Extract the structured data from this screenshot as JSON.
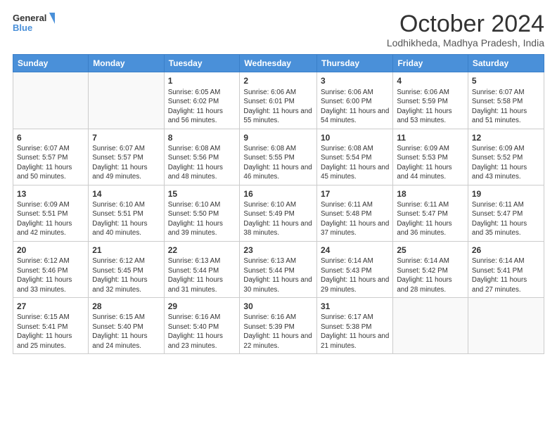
{
  "logo": {
    "line1": "General",
    "line2": "Blue"
  },
  "title": "October 2024",
  "subtitle": "Lodhikheda, Madhya Pradesh, India",
  "days_of_week": [
    "Sunday",
    "Monday",
    "Tuesday",
    "Wednesday",
    "Thursday",
    "Friday",
    "Saturday"
  ],
  "weeks": [
    [
      {
        "day": "",
        "info": ""
      },
      {
        "day": "",
        "info": ""
      },
      {
        "day": "1",
        "info": "Sunrise: 6:05 AM\nSunset: 6:02 PM\nDaylight: 11 hours and 56 minutes."
      },
      {
        "day": "2",
        "info": "Sunrise: 6:06 AM\nSunset: 6:01 PM\nDaylight: 11 hours and 55 minutes."
      },
      {
        "day": "3",
        "info": "Sunrise: 6:06 AM\nSunset: 6:00 PM\nDaylight: 11 hours and 54 minutes."
      },
      {
        "day": "4",
        "info": "Sunrise: 6:06 AM\nSunset: 5:59 PM\nDaylight: 11 hours and 53 minutes."
      },
      {
        "day": "5",
        "info": "Sunrise: 6:07 AM\nSunset: 5:58 PM\nDaylight: 11 hours and 51 minutes."
      }
    ],
    [
      {
        "day": "6",
        "info": "Sunrise: 6:07 AM\nSunset: 5:57 PM\nDaylight: 11 hours and 50 minutes."
      },
      {
        "day": "7",
        "info": "Sunrise: 6:07 AM\nSunset: 5:57 PM\nDaylight: 11 hours and 49 minutes."
      },
      {
        "day": "8",
        "info": "Sunrise: 6:08 AM\nSunset: 5:56 PM\nDaylight: 11 hours and 48 minutes."
      },
      {
        "day": "9",
        "info": "Sunrise: 6:08 AM\nSunset: 5:55 PM\nDaylight: 11 hours and 46 minutes."
      },
      {
        "day": "10",
        "info": "Sunrise: 6:08 AM\nSunset: 5:54 PM\nDaylight: 11 hours and 45 minutes."
      },
      {
        "day": "11",
        "info": "Sunrise: 6:09 AM\nSunset: 5:53 PM\nDaylight: 11 hours and 44 minutes."
      },
      {
        "day": "12",
        "info": "Sunrise: 6:09 AM\nSunset: 5:52 PM\nDaylight: 11 hours and 43 minutes."
      }
    ],
    [
      {
        "day": "13",
        "info": "Sunrise: 6:09 AM\nSunset: 5:51 PM\nDaylight: 11 hours and 42 minutes."
      },
      {
        "day": "14",
        "info": "Sunrise: 6:10 AM\nSunset: 5:51 PM\nDaylight: 11 hours and 40 minutes."
      },
      {
        "day": "15",
        "info": "Sunrise: 6:10 AM\nSunset: 5:50 PM\nDaylight: 11 hours and 39 minutes."
      },
      {
        "day": "16",
        "info": "Sunrise: 6:10 AM\nSunset: 5:49 PM\nDaylight: 11 hours and 38 minutes."
      },
      {
        "day": "17",
        "info": "Sunrise: 6:11 AM\nSunset: 5:48 PM\nDaylight: 11 hours and 37 minutes."
      },
      {
        "day": "18",
        "info": "Sunrise: 6:11 AM\nSunset: 5:47 PM\nDaylight: 11 hours and 36 minutes."
      },
      {
        "day": "19",
        "info": "Sunrise: 6:11 AM\nSunset: 5:47 PM\nDaylight: 11 hours and 35 minutes."
      }
    ],
    [
      {
        "day": "20",
        "info": "Sunrise: 6:12 AM\nSunset: 5:46 PM\nDaylight: 11 hours and 33 minutes."
      },
      {
        "day": "21",
        "info": "Sunrise: 6:12 AM\nSunset: 5:45 PM\nDaylight: 11 hours and 32 minutes."
      },
      {
        "day": "22",
        "info": "Sunrise: 6:13 AM\nSunset: 5:44 PM\nDaylight: 11 hours and 31 minutes."
      },
      {
        "day": "23",
        "info": "Sunrise: 6:13 AM\nSunset: 5:44 PM\nDaylight: 11 hours and 30 minutes."
      },
      {
        "day": "24",
        "info": "Sunrise: 6:14 AM\nSunset: 5:43 PM\nDaylight: 11 hours and 29 minutes."
      },
      {
        "day": "25",
        "info": "Sunrise: 6:14 AM\nSunset: 5:42 PM\nDaylight: 11 hours and 28 minutes."
      },
      {
        "day": "26",
        "info": "Sunrise: 6:14 AM\nSunset: 5:41 PM\nDaylight: 11 hours and 27 minutes."
      }
    ],
    [
      {
        "day": "27",
        "info": "Sunrise: 6:15 AM\nSunset: 5:41 PM\nDaylight: 11 hours and 25 minutes."
      },
      {
        "day": "28",
        "info": "Sunrise: 6:15 AM\nSunset: 5:40 PM\nDaylight: 11 hours and 24 minutes."
      },
      {
        "day": "29",
        "info": "Sunrise: 6:16 AM\nSunset: 5:40 PM\nDaylight: 11 hours and 23 minutes."
      },
      {
        "day": "30",
        "info": "Sunrise: 6:16 AM\nSunset: 5:39 PM\nDaylight: 11 hours and 22 minutes."
      },
      {
        "day": "31",
        "info": "Sunrise: 6:17 AM\nSunset: 5:38 PM\nDaylight: 11 hours and 21 minutes."
      },
      {
        "day": "",
        "info": ""
      },
      {
        "day": "",
        "info": ""
      }
    ]
  ]
}
